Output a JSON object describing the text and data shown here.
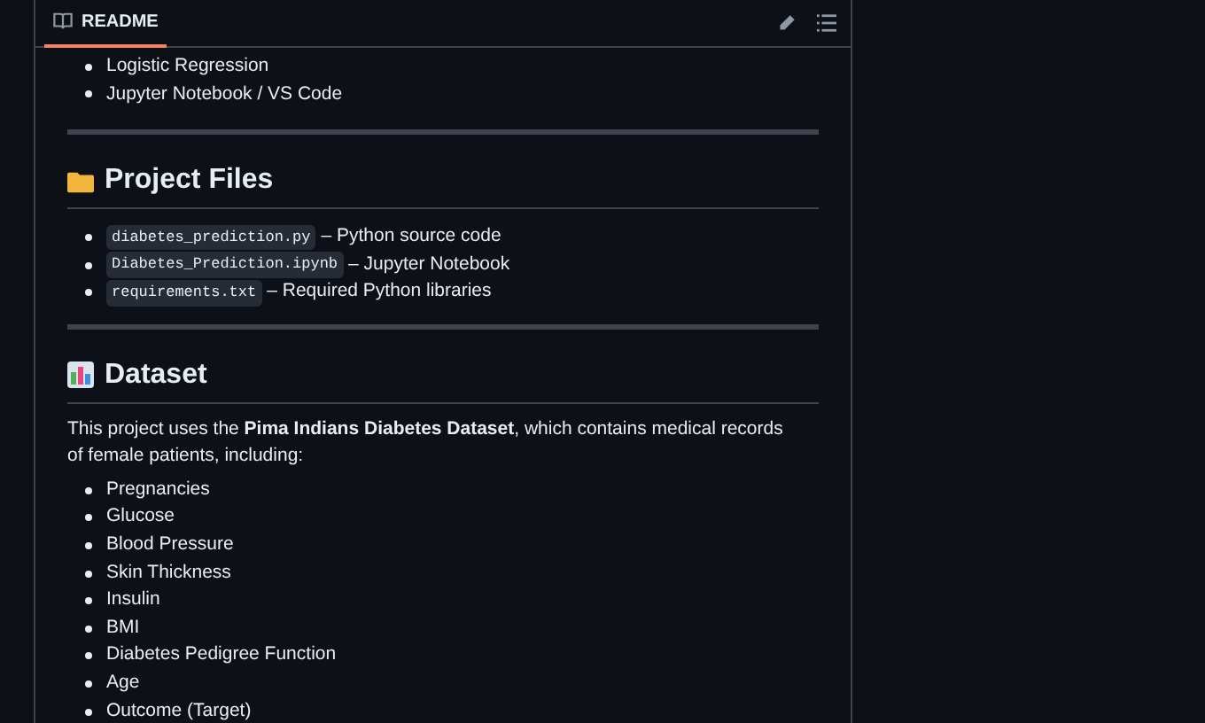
{
  "tab": {
    "label": "README",
    "selected": true
  },
  "tools_list": [
    "Logistic Regression",
    "Jupyter Notebook / VS Code"
  ],
  "files_section": {
    "heading": "Project Files",
    "files": [
      {
        "name": "diabetes_prediction.py",
        "description": "– Python source code"
      },
      {
        "name": "Diabetes_Prediction.ipynb",
        "description": "– Jupyter Notebook"
      },
      {
        "name": "requirements.txt",
        "description": "– Required Python libraries"
      }
    ]
  },
  "dataset_section": {
    "heading": "Dataset",
    "intro": "This project uses the **Pima Indians Diabetes Dataset**, which contains medical records of female patients, including:",
    "features": [
      "Pregnancies",
      "Glucose",
      "Blood Pressure",
      "Skin Thickness",
      "Insulin",
      "BMI",
      "Diabetes Pedigree Function",
      "Age",
      "Outcome (Target)"
    ]
  }
}
